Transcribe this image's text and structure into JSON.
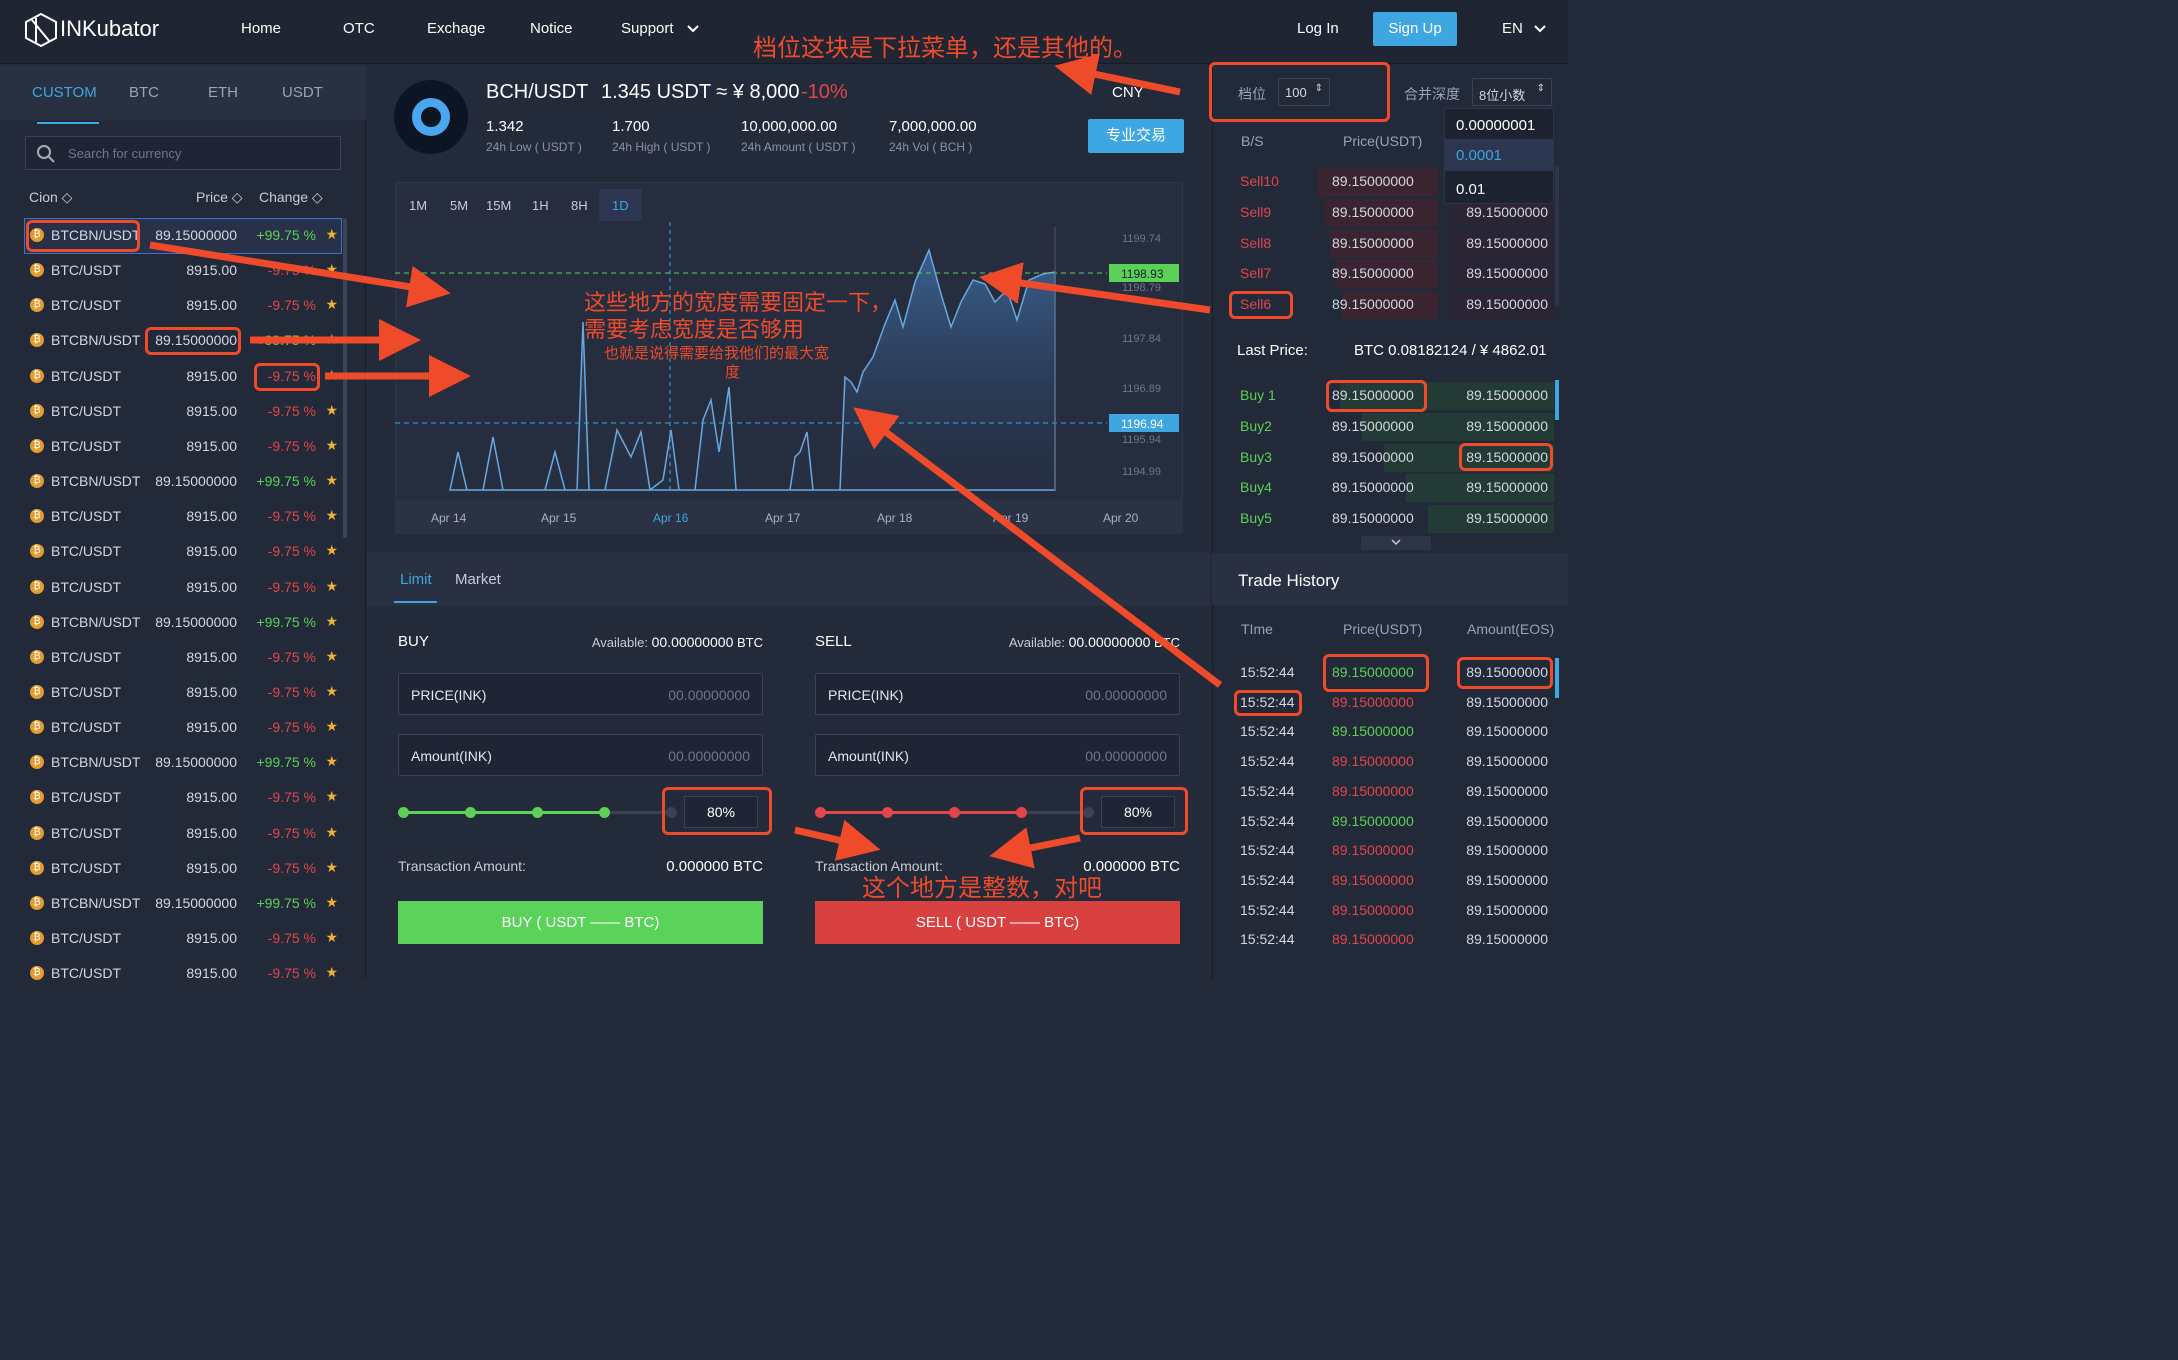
{
  "header": {
    "logo": "INKubator",
    "nav": [
      "Home",
      "OTC",
      "Exchage",
      "Notice",
      "Support"
    ],
    "login": "Log In",
    "signup": "Sign Up",
    "lang": "EN"
  },
  "left": {
    "tabs": [
      "CUSTOM",
      "BTC",
      "ETH",
      "USDT"
    ],
    "search_placeholder": "Search for currency",
    "col_coin": "Cion ◇",
    "col_price": "Price ◇",
    "col_change": "Change ◇",
    "rows": [
      {
        "name": "BTCBN/USDT",
        "price": "89.15000000",
        "change": "+99.75 %",
        "dir": "up"
      },
      {
        "name": "BTC/USDT",
        "price": "8915.00",
        "change": "-9.75 %",
        "dir": "dn"
      },
      {
        "name": "BTC/USDT",
        "price": "8915.00",
        "change": "-9.75 %",
        "dir": "dn"
      },
      {
        "name": "BTCBN/USDT",
        "price": "89.15000000",
        "change": "+99.75 %",
        "dir": "up"
      },
      {
        "name": "BTC/USDT",
        "price": "8915.00",
        "change": "-9.75 %",
        "dir": "dn"
      },
      {
        "name": "BTC/USDT",
        "price": "8915.00",
        "change": "-9.75 %",
        "dir": "dn"
      },
      {
        "name": "BTC/USDT",
        "price": "8915.00",
        "change": "-9.75 %",
        "dir": "dn"
      },
      {
        "name": "BTCBN/USDT",
        "price": "89.15000000",
        "change": "+99.75 %",
        "dir": "up"
      },
      {
        "name": "BTC/USDT",
        "price": "8915.00",
        "change": "-9.75 %",
        "dir": "dn"
      },
      {
        "name": "BTC/USDT",
        "price": "8915.00",
        "change": "-9.75 %",
        "dir": "dn"
      },
      {
        "name": "BTC/USDT",
        "price": "8915.00",
        "change": "-9.75 %",
        "dir": "dn"
      },
      {
        "name": "BTCBN/USDT",
        "price": "89.15000000",
        "change": "+99.75 %",
        "dir": "up"
      },
      {
        "name": "BTC/USDT",
        "price": "8915.00",
        "change": "-9.75 %",
        "dir": "dn"
      },
      {
        "name": "BTC/USDT",
        "price": "8915.00",
        "change": "-9.75 %",
        "dir": "dn"
      },
      {
        "name": "BTC/USDT",
        "price": "8915.00",
        "change": "-9.75 %",
        "dir": "dn"
      },
      {
        "name": "BTCBN/USDT",
        "price": "89.15000000",
        "change": "+99.75 %",
        "dir": "up"
      },
      {
        "name": "BTC/USDT",
        "price": "8915.00",
        "change": "-9.75 %",
        "dir": "dn"
      },
      {
        "name": "BTC/USDT",
        "price": "8915.00",
        "change": "-9.75 %",
        "dir": "dn"
      },
      {
        "name": "BTC/USDT",
        "price": "8915.00",
        "change": "-9.75 %",
        "dir": "dn"
      },
      {
        "name": "BTCBN/USDT",
        "price": "89.15000000",
        "change": "+99.75 %",
        "dir": "up"
      },
      {
        "name": "BTC/USDT",
        "price": "8915.00",
        "change": "-9.75 %",
        "dir": "dn"
      },
      {
        "name": "BTC/USDT",
        "price": "8915.00",
        "change": "-9.75 %",
        "dir": "dn"
      }
    ]
  },
  "ticker": {
    "pair": "BCH/USDT",
    "price": "1.345 USDT ≈ ¥ 8,000",
    "change": "-10%",
    "currency": "CNY",
    "pro": "专业交易",
    "stats": [
      {
        "v": "1.342",
        "k": "24h Low ( USDT )"
      },
      {
        "v": "1.700",
        "k": "24h High ( USDT )"
      },
      {
        "v": "10,000,000.00",
        "k": "24h Amount ( USDT )"
      },
      {
        "v": "7,000,000.00",
        "k": "24h Vol ( BCH )"
      }
    ]
  },
  "chart": {
    "periods": [
      "1M",
      "5M",
      "15M",
      "1H",
      "8H",
      "1D"
    ],
    "active": "1D"
  },
  "chart_data": {
    "type": "area",
    "x": [
      "Apr 14",
      "Apr 15",
      "Apr 16",
      "Apr 17",
      "Apr 18",
      "Apr 19",
      "Apr 20"
    ],
    "y_ticks": [
      "1199.74",
      "1198.79",
      "1197.84",
      "1196.89",
      "1195.94",
      "1194.99"
    ],
    "markers": [
      "1198.93",
      "1196.94"
    ]
  },
  "order": {
    "tabs": [
      "Limit",
      "Market"
    ],
    "buy": {
      "title": "BUY",
      "avail_label": "Available:",
      "avail": "00.00000000",
      "avail_unit": "BTC",
      "price_label": "PRICE(INK)",
      "amount_label": "Amount(INK)",
      "placeholder": "00.00000000",
      "pct": "80%",
      "tx_label": "Transaction Amount:",
      "tx": "0.000000 BTC",
      "btn": "BUY ( USDT —— BTC)"
    },
    "sell": {
      "title": "SELL",
      "avail_label": "Available:",
      "avail": "00.00000000",
      "avail_unit": "BTC",
      "price_label": "PRICE(INK)",
      "amount_label": "Amount(INK)",
      "placeholder": "00.00000000",
      "pct": "80%",
      "tx_label": "Transaction Amount:",
      "tx": "0.000000 BTC",
      "btn": "SELL ( USDT —— BTC)"
    }
  },
  "book": {
    "level_label": "档位",
    "level": "100",
    "merge_label": "合并深度",
    "merge": "8位小数",
    "dropdown": [
      "0.00000001",
      "0.0001",
      "0.01"
    ],
    "col_bs": "B/S",
    "col_price": "Price(USDT)",
    "sells": [
      {
        "l": "Sell10",
        "p": "89.15000000",
        "a": ""
      },
      {
        "l": "Sell9",
        "p": "89.15000000",
        "a": "89.15000000"
      },
      {
        "l": "Sell8",
        "p": "89.15000000",
        "a": "89.15000000"
      },
      {
        "l": "Sell7",
        "p": "89.15000000",
        "a": "89.15000000"
      },
      {
        "l": "Sell6",
        "p": "89.15000000",
        "a": "89.15000000"
      }
    ],
    "last_label": "Last Price:",
    "last": "BTC 0.08182124  /  ¥ 4862.01",
    "buys": [
      {
        "l": "Buy 1",
        "p": "89.15000000",
        "a": "89.15000000"
      },
      {
        "l": "Buy2",
        "p": "89.15000000",
        "a": "89.15000000"
      },
      {
        "l": "Buy3",
        "p": "89.15000000",
        "a": "89.15000000"
      },
      {
        "l": "Buy4",
        "p": "89.15000000",
        "a": "89.15000000"
      },
      {
        "l": "Buy5",
        "p": "89.15000000",
        "a": "89.15000000"
      }
    ]
  },
  "history": {
    "title": "Trade History",
    "col_time": "TIme",
    "col_price": "Price(USDT)",
    "col_amount": "Amount(EOS)",
    "rows": [
      {
        "t": "15:52:44",
        "p": "89.15000000",
        "a": "89.15000000",
        "d": "up"
      },
      {
        "t": "15:52:44",
        "p": "89.15000000",
        "a": "89.15000000",
        "d": "dn"
      },
      {
        "t": "15:52:44",
        "p": "89.15000000",
        "a": "89.15000000",
        "d": "up"
      },
      {
        "t": "15:52:44",
        "p": "89.15000000",
        "a": "89.15000000",
        "d": "dn"
      },
      {
        "t": "15:52:44",
        "p": "89.15000000",
        "a": "89.15000000",
        "d": "dn"
      },
      {
        "t": "15:52:44",
        "p": "89.15000000",
        "a": "89.15000000",
        "d": "up"
      },
      {
        "t": "15:52:44",
        "p": "89.15000000",
        "a": "89.15000000",
        "d": "dn"
      },
      {
        "t": "15:52:44",
        "p": "89.15000000",
        "a": "89.15000000",
        "d": "dn"
      },
      {
        "t": "15:52:44",
        "p": "89.15000000",
        "a": "89.15000000",
        "d": "dn"
      },
      {
        "t": "15:52:44",
        "p": "89.15000000",
        "a": "89.15000000",
        "d": "dn"
      }
    ]
  },
  "notes": {
    "top": "档位这块是下拉菜单，还是其他的。",
    "mid1": "这些地方的宽度需要固定一下，",
    "mid2": "需要考虑宽度是否够用",
    "mid3": "也就是说得需要给我他们的最大宽",
    "mid4": "度",
    "bottom": "这个地方是整数，对吧"
  }
}
